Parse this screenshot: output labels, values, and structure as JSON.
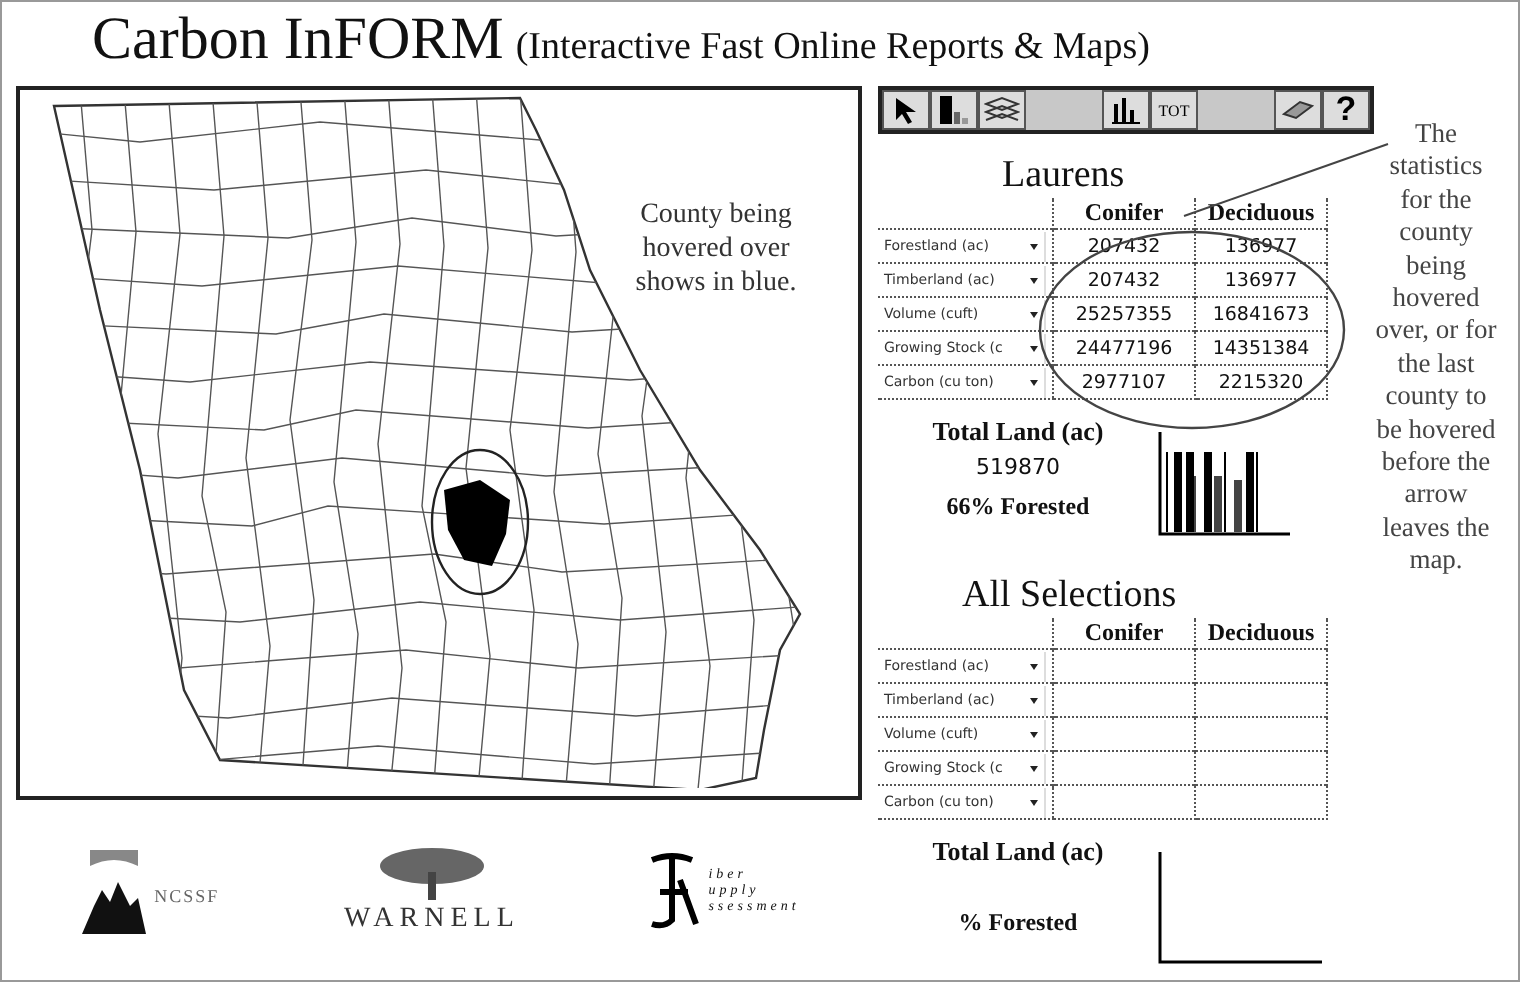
{
  "title": {
    "name": "Carbon InFORM",
    "subtitle": "(Interactive Fast Online Reports & Maps)"
  },
  "map": {
    "callout": "County being hovered over shows in blue."
  },
  "logos": [
    {
      "kind": "ncssf",
      "texts": [
        "NCSSF"
      ]
    },
    {
      "kind": "warnell",
      "texts": [
        "WARNELL"
      ]
    },
    {
      "kind": "fsa",
      "texts": [
        "iber",
        "upply",
        "ssessment"
      ]
    }
  ],
  "toolbar": [
    {
      "items": [
        {
          "kind": "pointer"
        },
        {
          "kind": "shade"
        },
        {
          "kind": "layers"
        }
      ]
    },
    {
      "items": [
        {
          "kind": "chart"
        },
        {
          "kind": "text",
          "label": "TOT"
        }
      ]
    },
    {
      "items": [
        {
          "kind": "eraser"
        },
        {
          "kind": "text",
          "label": "?"
        }
      ]
    }
  ],
  "current": {
    "title": "Laurens",
    "columns": [
      "Conifer",
      "Deciduous"
    ],
    "rows": [
      {
        "label": "Forestland (ac)",
        "values": [
          "207432",
          "136977"
        ]
      },
      {
        "label": "Timberland (ac)",
        "values": [
          "207432",
          "136977"
        ]
      },
      {
        "label": "Volume (cuft)",
        "values": [
          "25257355",
          "16841673"
        ]
      },
      {
        "label": "Growing Stock (c",
        "values": [
          "24477196",
          "14351384"
        ]
      },
      {
        "label": "Carbon (cu ton)",
        "values": [
          "2977107",
          "2215320"
        ]
      }
    ],
    "total_label": "Total Land (ac)",
    "total": "519870",
    "forested": "66% Forested",
    "chart": true
  },
  "all": {
    "title": "All Selections",
    "columns": [
      "Conifer",
      "Deciduous"
    ],
    "rows": [
      {
        "label": "Forestland (ac)"
      },
      {
        "label": "Timberland (ac)"
      },
      {
        "label": "Volume (cuft)"
      },
      {
        "label": "Growing Stock (c"
      },
      {
        "label": "Carbon (cu ton)"
      }
    ],
    "total_label": "Total Land (ac)",
    "forested": "% Forested",
    "chart": false
  },
  "annotation": "The statistics for the county being hovered over, or for the last county to be hovered before the arrow leaves the map."
}
